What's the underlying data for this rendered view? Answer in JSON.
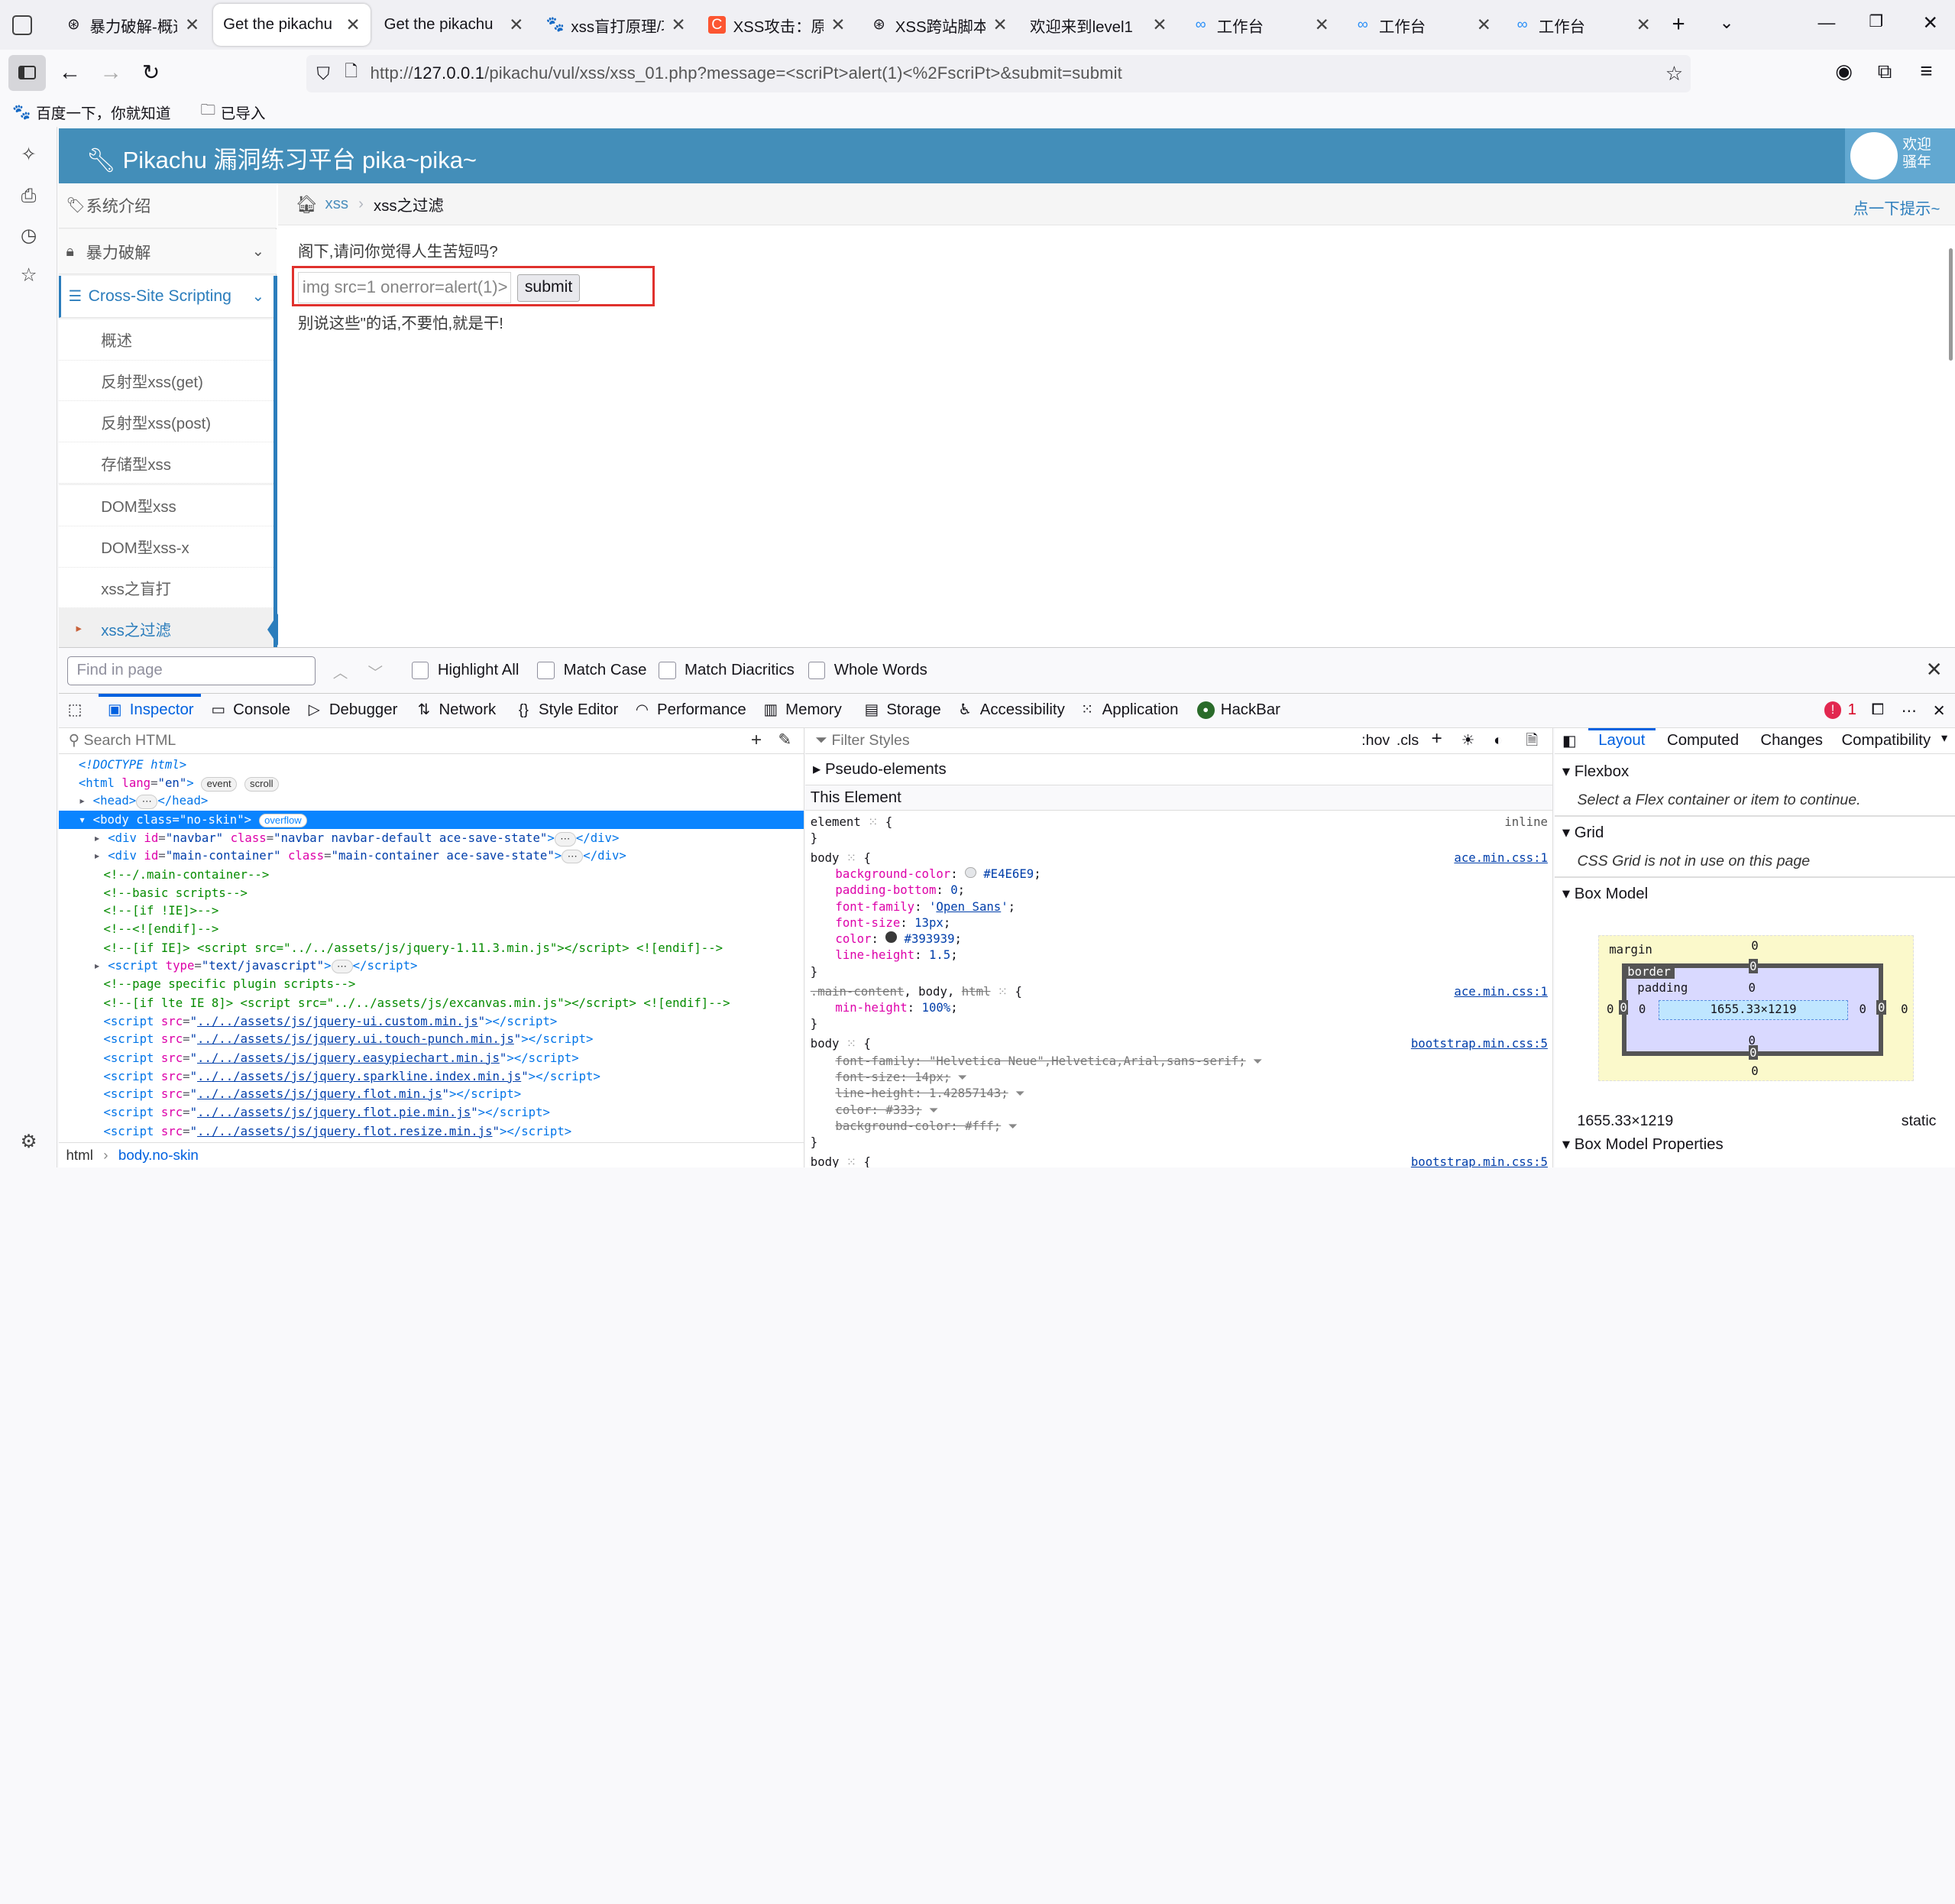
{
  "browser": {
    "tabs": [
      {
        "icon": "tab-icon-swirl",
        "label": "暴力破解-概述",
        "active": false
      },
      {
        "icon": "",
        "label": "Get the pikachu",
        "active": true
      },
      {
        "icon": "",
        "label": "Get the pikachu",
        "active": false
      },
      {
        "icon": "baidu-paw-icon",
        "label": "xss盲打原理/攻",
        "active": false
      },
      {
        "icon": "csdn-c-icon",
        "label": "XSS攻击：原理",
        "active": false
      },
      {
        "icon": "tab-icon-swirl",
        "label": "XSS跨站脚本-D",
        "active": false
      },
      {
        "icon": "",
        "label": "欢迎来到level1",
        "active": false
      },
      {
        "icon": "workbench-icon",
        "label": "工作台",
        "active": false
      },
      {
        "icon": "workbench-icon",
        "label": "工作台",
        "active": false
      },
      {
        "icon": "workbench-icon",
        "label": "工作台",
        "active": false
      }
    ],
    "url_prefix": "http://",
    "url_host": "127.0.0.1",
    "url_path": "/pikachu/vul/xss/xss_01.php?message=<scriPt>alert(1)<%2FscriPt>&submit=submit",
    "bookmarks": [
      "百度一下，你就知道",
      "已导入"
    ]
  },
  "page": {
    "brand": "Pikachu 漏洞练习平台 pika~pika~",
    "welcome_line1": "欢迎",
    "welcome_line2": "骚年",
    "sidebar": {
      "menus": [
        {
          "label": "系统介绍",
          "open": false
        },
        {
          "label": "暴力破解",
          "open": false
        },
        {
          "label": "Cross-Site Scripting",
          "open": true
        }
      ],
      "submenus": [
        "概述",
        "反射型xss(get)",
        "反射型xss(post)",
        "存储型xss",
        "DOM型xss",
        "DOM型xss-x",
        "xss之盲打",
        "xss之过滤"
      ],
      "active_submenu": "xss之过滤"
    },
    "breadcrumb": {
      "link": "xss",
      "current": "xss之过滤"
    },
    "hint": "点一下提示~",
    "question": "阁下,请问你觉得人生苦短吗?",
    "input_value": "img src=1 onerror=alert(1)>",
    "submit_label": "submit",
    "message": "别说这些\"的话,不要怕,就是干!"
  },
  "findbar": {
    "placeholder": "Find in page",
    "options": [
      "Highlight All",
      "Match Case",
      "Match Diacritics",
      "Whole Words"
    ]
  },
  "devtools": {
    "tabs": [
      "Inspector",
      "Console",
      "Debugger",
      "Network",
      "Style Editor",
      "Performance",
      "Memory",
      "Storage",
      "Accessibility",
      "Application",
      "HackBar"
    ],
    "active_tab": "Inspector",
    "error_count": "1",
    "search_html_placeholder": "Search HTML",
    "breadcrumb": [
      "html",
      "body.no-skin"
    ],
    "filter_styles_placeholder": "Filter Styles",
    "hov": ":hov",
    "cls": ".cls",
    "pseudo_elements": "Pseudo-elements",
    "this_element": "This Element",
    "layout_tabs": [
      "Layout",
      "Computed",
      "Changes",
      "Compatibility"
    ],
    "flexbox_title": "Flexbox",
    "flexbox_note": "Select a Flex container or item to continue.",
    "grid_title": "Grid",
    "grid_note": "CSS Grid is not in use on this page",
    "boxmodel_title": "Box Model",
    "boxmodel": {
      "margin_label": "margin",
      "border_label": "border",
      "padding_label": "padding",
      "content": "1655.33×1219",
      "zero": "0"
    },
    "dimensions": "1655.33×1219",
    "position": "static",
    "box_model_props": "Box Model Properties"
  }
}
